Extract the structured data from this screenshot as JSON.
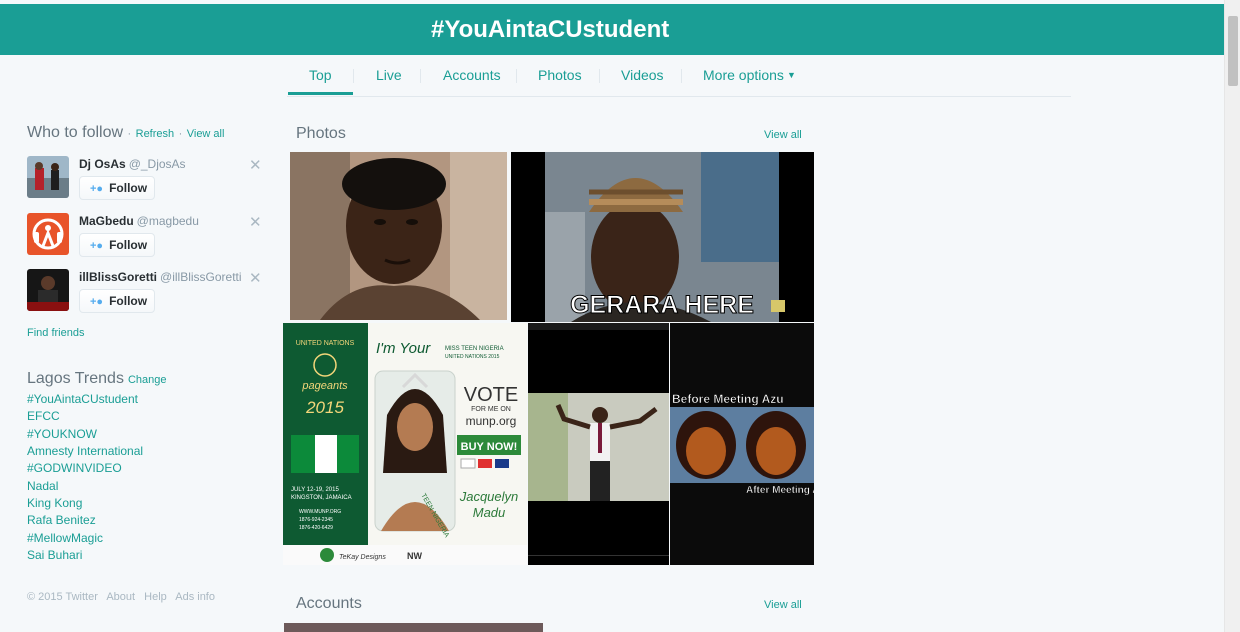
{
  "header": {
    "title": "#YouAintaCUstudent"
  },
  "nav": {
    "tabs": [
      "Top",
      "Live",
      "Accounts",
      "Photos",
      "Videos"
    ],
    "more": "More options"
  },
  "who_to_follow": {
    "title": "Who to follow",
    "refresh": "Refresh",
    "view_all": "View all",
    "follow_label": "Follow",
    "users": [
      {
        "name": "Dj OsAs",
        "handle": "@_DjosAs"
      },
      {
        "name": "MaGbedu",
        "handle": "@magbedu"
      },
      {
        "name": "illBlissGoretti",
        "handle": "@illBlissGoretti"
      }
    ],
    "find_friends": "Find friends"
  },
  "trends": {
    "title": "Lagos Trends",
    "change": "Change",
    "items": [
      "#YouAintaCUstudent",
      "EFCC",
      "#YOUKNOW",
      "Amnesty International",
      "#GODWINVIDEO",
      "Nadal",
      "King Kong",
      "Rafa Benitez",
      "#MellowMagic",
      "Sai Buhari"
    ]
  },
  "footer": {
    "links": [
      "© 2015 Twitter",
      "About",
      "Help",
      "Ads info"
    ]
  },
  "photos": {
    "title": "Photos",
    "view_all": "View all",
    "captions": {
      "gerara": "GERARA HERE",
      "un_logo": "UNITED NATIONS",
      "pageants": "pageants",
      "year": "2015",
      "im_your": "I'm Your",
      "miss_teen": "MISS TEEN NIGERIA",
      "un_2015": "UNITED NATIONS 2015",
      "vote": "VOTE",
      "for_me_on": "FOR ME ON",
      "site": "munp.org",
      "buy_now": "BUY NOW!",
      "first_name": "Jacquelyn",
      "last_name": "Madu",
      "dates": "JULY 12-19, 2015",
      "city": "KINGSTON, JAMAICA",
      "contact1": "WWW.MUNP.ORG",
      "contact2": "1876-924-2345",
      "contact3": "1876-420-6429",
      "sash": "TEEN NIGERIA",
      "tk": "TeKay Designs",
      "nw": "NW",
      "before": "Before Meeting Azu",
      "after": "After Meeting Azu"
    }
  },
  "accounts": {
    "title": "Accounts",
    "view_all": "View all"
  },
  "colors": {
    "accent": "#1a9e95",
    "header_bg": "#1a9e95",
    "page_bg": "#f5f8fa"
  }
}
